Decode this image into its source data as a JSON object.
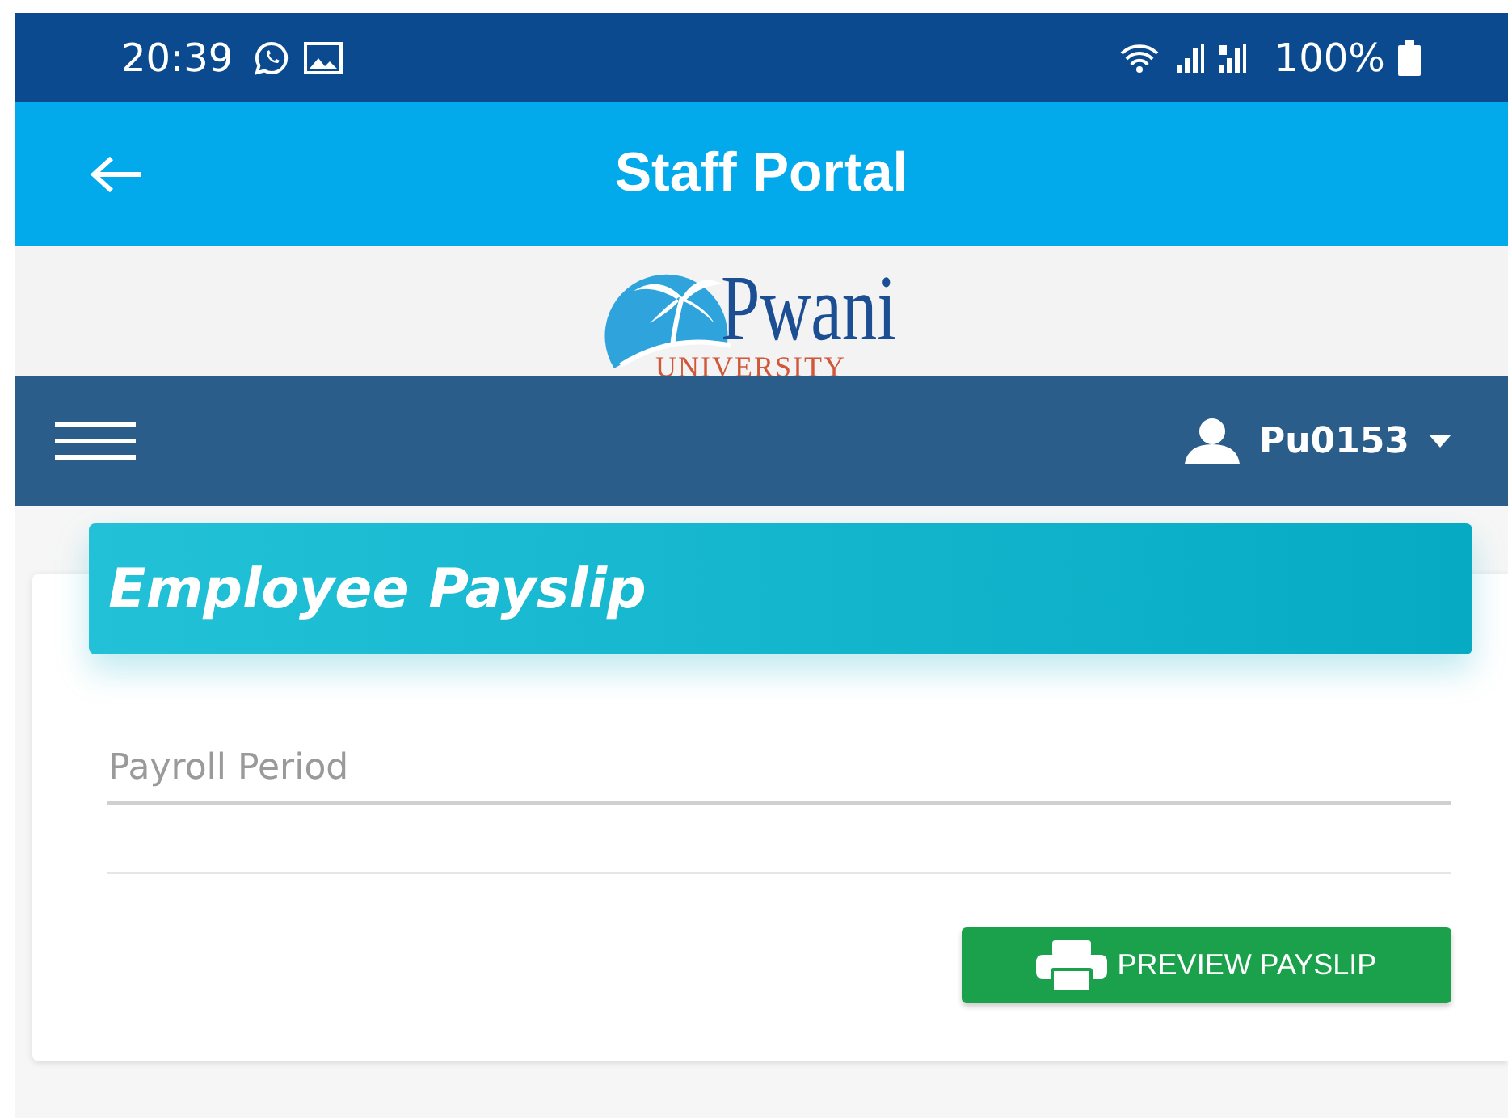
{
  "status_bar": {
    "time": "20:39",
    "battery": "100%"
  },
  "app_bar": {
    "title": "Staff Portal"
  },
  "logo": {
    "name": "Pwani",
    "subtitle": "UNIVERSITY"
  },
  "nav": {
    "user": "Pu0153"
  },
  "card": {
    "title": "Employee Payslip",
    "fields": [
      {
        "placeholder": "Payroll Period"
      }
    ],
    "buttons": [
      "PREVIEW PAYSLIP"
    ]
  }
}
